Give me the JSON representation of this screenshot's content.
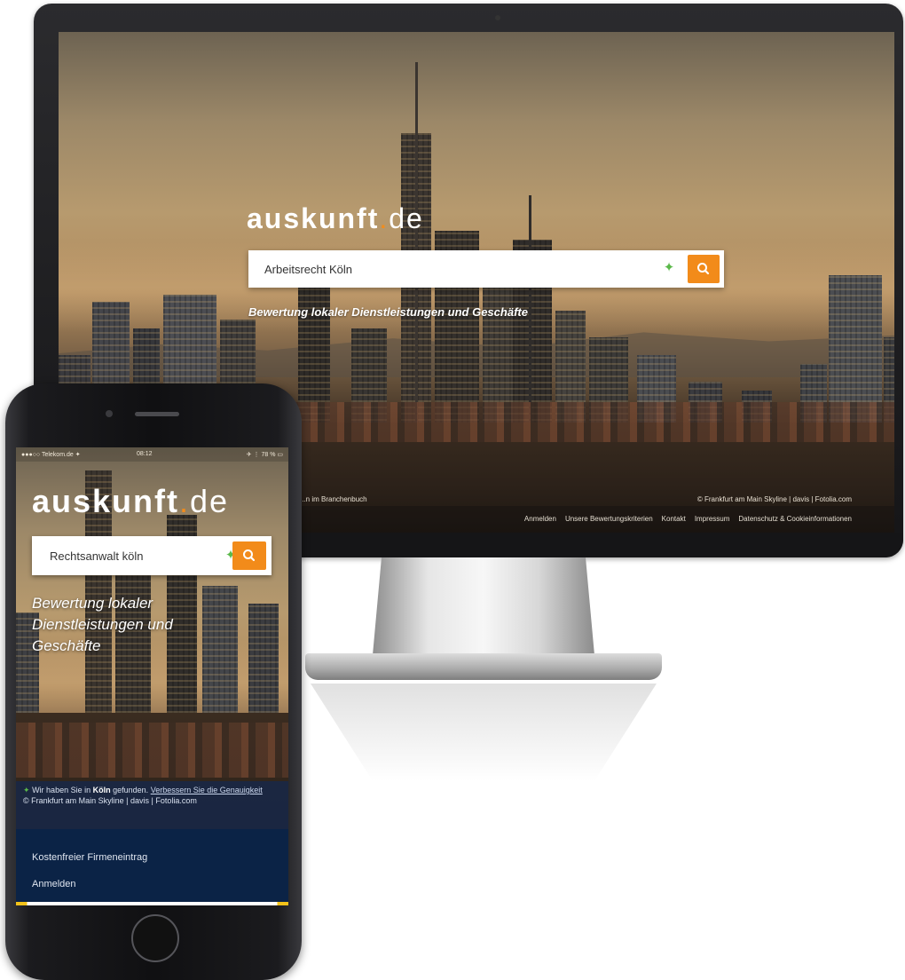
{
  "desktop": {
    "logo": {
      "name": "auskunft",
      "tld": ".de"
    },
    "search": {
      "value": "Arbeitsrecht Köln"
    },
    "tagline": "Bewertung lokaler Dienstleistungen und Geschäfte",
    "credit_left": "...n im Branchenbuch",
    "credit_right": "© Frankfurt am Main Skyline | davis | Fotolia.com",
    "footer_links": [
      "Anmelden",
      "Unsere Bewertungskriterien",
      "Kontakt",
      "Impressum",
      "Datenschutz & Cookieinformationen"
    ]
  },
  "mobile": {
    "status": {
      "carrier": "●●●○○ Telekom.de ✦",
      "time": "08:12",
      "battery": "✈ ⋮ 78 % ▭"
    },
    "logo": {
      "name": "auskunft",
      "tld": ".de"
    },
    "search": {
      "value": "Rechtsanwalt köln"
    },
    "tagline": "Bewertung lokaler Dienstleistungen und Geschäfte",
    "info": {
      "pin": "✦",
      "prefix": "Wir haben Sie in",
      "city": "Köln",
      "suffix": "gefunden.",
      "improve_link": "Verbessern Sie die Genauigkeit",
      "credit": "© Frankfurt am Main Skyline | davis | Fotolia.com"
    },
    "menu": [
      "Kostenfreier Firmeneintrag",
      "Anmelden"
    ]
  },
  "colors": {
    "accent": "#f28b1a",
    "locate": "#5bb94a",
    "mobile_menu_bg": "#0b2346"
  },
  "icons": {
    "search": "search-icon",
    "locate": "locate-icon"
  }
}
